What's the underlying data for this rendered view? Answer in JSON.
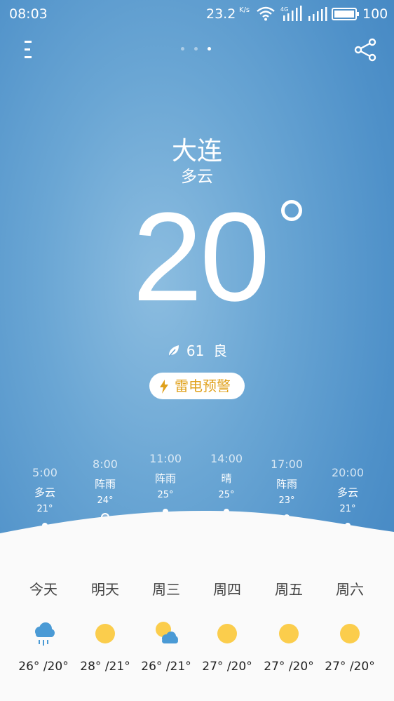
{
  "status_bar": {
    "time": "08:03",
    "net_speed": "23.2",
    "net_speed_unit": "K/s",
    "battery": "100",
    "network_type": "4G"
  },
  "header": {
    "menu_icon": "menu-icon",
    "share_icon": "share-icon",
    "page_count": 3,
    "active_page": 3
  },
  "current": {
    "city": "大连",
    "condition": "多云",
    "temperature": "20",
    "aqi_value": "61",
    "aqi_label": "良",
    "warning": "雷电预警"
  },
  "hourly": [
    {
      "time": "5:00",
      "cond": "多云",
      "temp": "21°"
    },
    {
      "time": "8:00",
      "cond": "阵雨",
      "temp": "24°"
    },
    {
      "time": "11:00",
      "cond": "阵雨",
      "temp": "25°"
    },
    {
      "time": "14:00",
      "cond": "晴",
      "temp": "25°"
    },
    {
      "time": "17:00",
      "cond": "阵雨",
      "temp": "23°"
    },
    {
      "time": "20:00",
      "cond": "多云",
      "temp": "21°"
    }
  ],
  "daily": [
    {
      "day": "今天",
      "icon": "rain-cloud-icon",
      "range": "26° /20°"
    },
    {
      "day": "明天",
      "icon": "sun-icon",
      "range": "28° /21°"
    },
    {
      "day": "周三",
      "icon": "partly-cloudy-icon",
      "range": "26° /21°"
    },
    {
      "day": "周四",
      "icon": "sun-icon",
      "range": "27° /20°"
    },
    {
      "day": "周五",
      "icon": "sun-icon",
      "range": "27° /20°"
    },
    {
      "day": "周六",
      "icon": "sun-icon",
      "range": "27° /20°"
    }
  ],
  "colors": {
    "sky": "#5b9bd0",
    "sun": "#fbcd4c",
    "rain": "#4a9ad5",
    "warning_text": "#e0a11c"
  }
}
